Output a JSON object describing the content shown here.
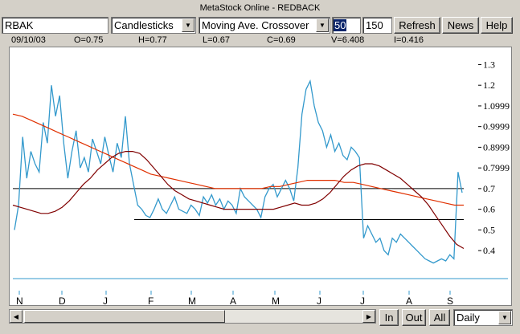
{
  "window": {
    "title": "MetaStock Online - REDBACK"
  },
  "toolbar": {
    "symbol": "RBAK",
    "chart_style": "Candlesticks",
    "indicator": "Moving Ave. Crossover",
    "ma_fast": "50",
    "ma_slow": "150",
    "refresh_label": "Refresh",
    "news_label": "News",
    "help_label": "Help"
  },
  "quote": {
    "date": "09/10/03",
    "open": "O=0.75",
    "high": "H=0.77",
    "low": "L=0.67",
    "close": "C=0.69",
    "volume": "V=6.408",
    "interest": "I=0.416"
  },
  "bottom": {
    "in_label": "In",
    "out_label": "Out",
    "all_label": "All",
    "period": "Daily"
  },
  "icons": {
    "dropdown": "chevron-down-icon",
    "scroll_left": "arrow-left-icon",
    "scroll_right": "arrow-right-icon"
  },
  "colors": {
    "price": "#3399cc",
    "ma_fast": "#800000",
    "ma_slow": "#e03000",
    "support": "#000000"
  },
  "chart_data": {
    "type": "line",
    "title": "",
    "xlabel": "",
    "ylabel": "",
    "x_tick_labels": [
      "N",
      "D",
      "J",
      "F",
      "M",
      "A",
      "M",
      "J",
      "J",
      "A",
      "S"
    ],
    "y_tick_labels": [
      "1.3",
      "1.2",
      "1.0999",
      "0.9999",
      "0.8999",
      "0.7999",
      "0.7",
      "0.6",
      "0.5",
      "0.4"
    ],
    "ylim": [
      0.28,
      1.36
    ],
    "grid": false,
    "horizontal_lines": [
      0.7,
      0.55
    ],
    "series": [
      {
        "kind": "price",
        "values": [
          0.5,
          0.62,
          0.95,
          0.75,
          0.88,
          0.82,
          0.78,
          1.02,
          0.92,
          1.2,
          1.05,
          1.15,
          0.92,
          0.75,
          0.88,
          0.98,
          0.8,
          0.85,
          0.78,
          0.94,
          0.88,
          0.82,
          0.95,
          0.86,
          0.78,
          0.92,
          0.85,
          1.05,
          0.82,
          0.72,
          0.62,
          0.6,
          0.57,
          0.56,
          0.6,
          0.65,
          0.6,
          0.58,
          0.62,
          0.66,
          0.6,
          0.59,
          0.58,
          0.62,
          0.6,
          0.57,
          0.66,
          0.63,
          0.67,
          0.62,
          0.65,
          0.6,
          0.64,
          0.62,
          0.58,
          0.7,
          0.66,
          0.64,
          0.62,
          0.6,
          0.56,
          0.66,
          0.7,
          0.72,
          0.66,
          0.7,
          0.74,
          0.7,
          0.64,
          0.8,
          1.06,
          1.18,
          1.22,
          1.1,
          1.02,
          0.98,
          0.9,
          0.96,
          0.88,
          0.92,
          0.86,
          0.84,
          0.9,
          0.88,
          0.85,
          0.46,
          0.52,
          0.48,
          0.44,
          0.46,
          0.4,
          0.38,
          0.46,
          0.44,
          0.48,
          0.46,
          0.44,
          0.42,
          0.4,
          0.38,
          0.36,
          0.35,
          0.34,
          0.35,
          0.36,
          0.35,
          0.38,
          0.36,
          0.78,
          0.68
        ]
      },
      {
        "kind": "ma_fast",
        "values": [
          0.62,
          0.61,
          0.6,
          0.59,
          0.58,
          0.58,
          0.59,
          0.61,
          0.64,
          0.68,
          0.72,
          0.75,
          0.79,
          0.82,
          0.85,
          0.87,
          0.88,
          0.88,
          0.87,
          0.84,
          0.8,
          0.76,
          0.72,
          0.69,
          0.67,
          0.65,
          0.64,
          0.63,
          0.62,
          0.61,
          0.6,
          0.6,
          0.6,
          0.6,
          0.6,
          0.6,
          0.6,
          0.6,
          0.61,
          0.62,
          0.63,
          0.62,
          0.62,
          0.63,
          0.65,
          0.68,
          0.72,
          0.76,
          0.79,
          0.81,
          0.82,
          0.82,
          0.81,
          0.79,
          0.77,
          0.75,
          0.72,
          0.69,
          0.66,
          0.62,
          0.57,
          0.52,
          0.47,
          0.43,
          0.41
        ]
      },
      {
        "kind": "ma_slow",
        "values": [
          1.06,
          1.05,
          1.03,
          1.01,
          0.99,
          0.97,
          0.95,
          0.93,
          0.91,
          0.89,
          0.87,
          0.85,
          0.83,
          0.81,
          0.79,
          0.77,
          0.76,
          0.75,
          0.74,
          0.73,
          0.72,
          0.71,
          0.7,
          0.7,
          0.7,
          0.7,
          0.7,
          0.7,
          0.71,
          0.71,
          0.72,
          0.73,
          0.74,
          0.74,
          0.74,
          0.74,
          0.73,
          0.73,
          0.72,
          0.71,
          0.7,
          0.69,
          0.68,
          0.67,
          0.66,
          0.65,
          0.64,
          0.63,
          0.62,
          0.62
        ]
      }
    ]
  }
}
